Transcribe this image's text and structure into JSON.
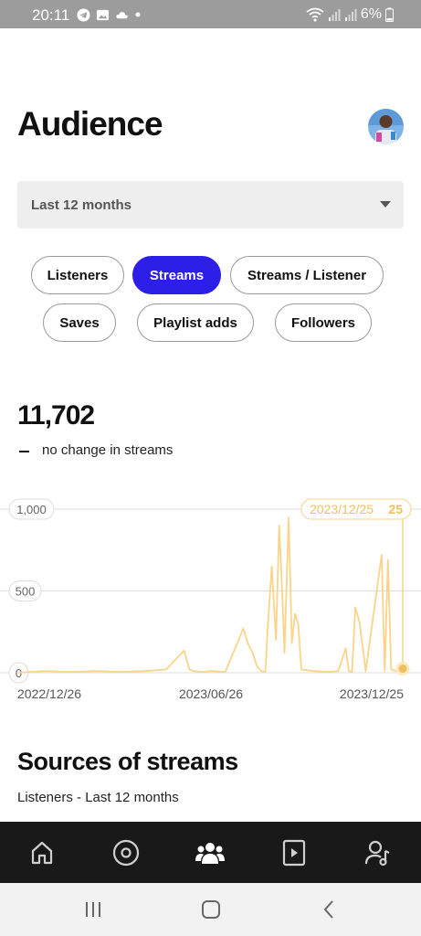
{
  "status_bar": {
    "time": "20:11",
    "battery": "6%",
    "left_icons": [
      "telegram-icon",
      "gallery-icon",
      "cloud-icon",
      "dot-icon"
    ],
    "right_icons": [
      "wifi-icon",
      "signal-icon",
      "signal-icon",
      "battery-icon"
    ]
  },
  "header": {
    "title": "Audience"
  },
  "range_select": {
    "value": "Last 12 months"
  },
  "chips": [
    {
      "label": "Listeners",
      "active": false
    },
    {
      "label": "Streams",
      "active": true
    },
    {
      "label": "Streams / Listener",
      "active": false
    },
    {
      "label": "Saves",
      "active": false
    },
    {
      "label": "Playlist adds",
      "active": false
    },
    {
      "label": "Followers",
      "active": false
    }
  ],
  "metric": {
    "value": "11,702",
    "change": "no change in streams"
  },
  "colors": {
    "accent": "#2d1ee8",
    "series": "#f9d48a",
    "tooltip_text": "#f0c060",
    "grid": "#dddddd"
  },
  "chart_data": {
    "type": "line",
    "y_ticks": [
      "1,000",
      "500",
      "0"
    ],
    "ylim": [
      0,
      1000
    ],
    "x_tick_labels": [
      "2022/12/26",
      "2023/06/26",
      "2023/12/25"
    ],
    "x": [
      "2022-12-26",
      "2023-01-20",
      "2023-02-15",
      "2023-03-10",
      "2023-04-01",
      "2023-04-25",
      "2023-05-15",
      "2023-06-01",
      "2023-06-06",
      "2023-06-10",
      "2023-06-20",
      "2023-06-26",
      "2023-07-10",
      "2023-07-27",
      "2023-08-01",
      "2023-08-05",
      "2023-08-09",
      "2023-08-13",
      "2023-08-17",
      "2023-08-19",
      "2023-08-23",
      "2023-08-27",
      "2023-08-30",
      "2023-09-02",
      "2023-09-04",
      "2023-09-08",
      "2023-09-11",
      "2023-09-14",
      "2023-09-17",
      "2023-09-20",
      "2023-10-01",
      "2023-10-15",
      "2023-10-25",
      "2023-11-01",
      "2023-11-04",
      "2023-11-07",
      "2023-11-10",
      "2023-11-14",
      "2023-11-20",
      "2023-12-05",
      "2023-12-08",
      "2023-12-11",
      "2023-12-14",
      "2023-12-18",
      "2023-12-25"
    ],
    "y": [
      0,
      10,
      5,
      10,
      5,
      10,
      20,
      135,
      20,
      10,
      5,
      10,
      5,
      270,
      170,
      120,
      40,
      10,
      5,
      260,
      650,
      200,
      900,
      480,
      120,
      950,
      180,
      360,
      300,
      20,
      10,
      5,
      10,
      150,
      10,
      5,
      400,
      310,
      10,
      720,
      10,
      690,
      20,
      10,
      25
    ],
    "tooltip": {
      "date": "2023/12/25",
      "value": "25"
    }
  },
  "sources": {
    "title": "Sources of streams",
    "subtitle": "Listeners - Last 12 months"
  },
  "bottom_nav": [
    "home-icon",
    "catalog-icon",
    "audience-icon",
    "video-icon",
    "profile-icon"
  ],
  "system_nav": [
    "recents-icon",
    "home-button-icon",
    "back-icon"
  ]
}
